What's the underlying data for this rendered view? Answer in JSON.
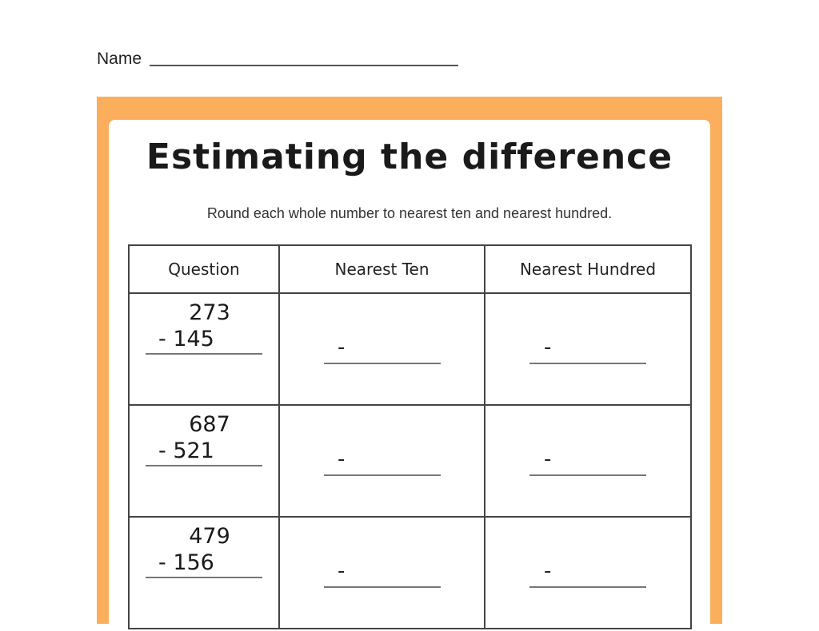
{
  "header": {
    "name_label": "Name"
  },
  "worksheet": {
    "title": "Estimating the difference",
    "instructions": "Round each whole number to nearest ten and nearest hundred.",
    "colors": {
      "frame": "#fbaf5d",
      "card": "#ffffff"
    },
    "columns": [
      "Question",
      "Nearest Ten",
      "Nearest Hundred"
    ],
    "rows": [
      {
        "minuend": "273",
        "subtrahend": "- 145",
        "ten_answer": "-",
        "hundred_answer": "-"
      },
      {
        "minuend": "687",
        "subtrahend": "- 521",
        "ten_answer": "-",
        "hundred_answer": "-"
      },
      {
        "minuend": "479",
        "subtrahend": "- 156",
        "ten_answer": "-",
        "hundred_answer": "-"
      }
    ]
  }
}
